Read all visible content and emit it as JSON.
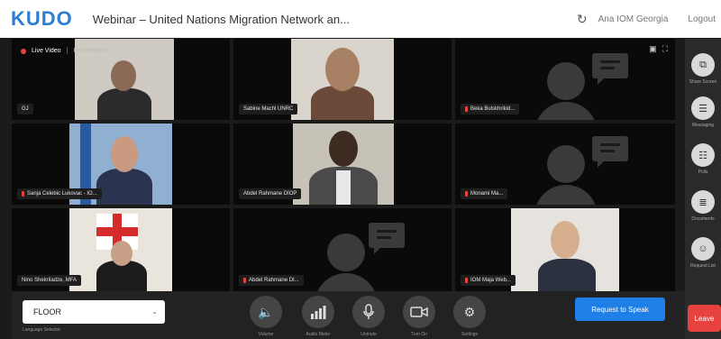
{
  "topbar": {
    "logo": "KUDO",
    "title": "Webinar – United Nations Migration Network an...",
    "refresh_icon": "refresh-icon",
    "user": "Ana IOM Georgia",
    "logout": "Logout"
  },
  "stage": {
    "live_label": "Live Video",
    "separator": "|",
    "presentation_label": "Presentation"
  },
  "tiles": [
    {
      "name": "GJ",
      "muted": false,
      "type": "video"
    },
    {
      "name": "Sabine Machl UNRC",
      "muted": false,
      "type": "video"
    },
    {
      "name": "Beka Bulskhrikid...",
      "muted": true,
      "type": "avatar"
    },
    {
      "name": "Sanja Celebic Lukovac - IO...",
      "muted": true,
      "type": "video"
    },
    {
      "name": "Abdel Rahmane DIOP",
      "muted": false,
      "type": "video"
    },
    {
      "name": "Monami Ma...",
      "muted": true,
      "type": "avatar"
    },
    {
      "name": "Nino Shekriladze, MFA",
      "muted": false,
      "type": "video"
    },
    {
      "name": "Abdel Rahmane DI...",
      "muted": true,
      "type": "avatar"
    },
    {
      "name": "IOM Maja Web...",
      "muted": true,
      "type": "video"
    }
  ],
  "sidebar": [
    {
      "label": "Share Screen",
      "icon": "share-screen-icon"
    },
    {
      "label": "Messaging",
      "icon": "messaging-icon"
    },
    {
      "label": "Polls",
      "icon": "polls-icon"
    },
    {
      "label": "Documents",
      "icon": "documents-icon"
    },
    {
      "label": "Request List",
      "icon": "request-list-icon"
    }
  ],
  "bottombar": {
    "floor_value": "FLOOR",
    "language_selector_label": "Language Selector",
    "controls": [
      {
        "label": "Volume",
        "icon": "volume-icon"
      },
      {
        "label": "Audio Meter",
        "icon": "audio-meter-icon"
      },
      {
        "label": "Unmute",
        "icon": "microphone-icon"
      },
      {
        "label": "Turn On",
        "icon": "camera-icon"
      },
      {
        "label": "Settings",
        "icon": "settings-gear-icon"
      }
    ],
    "request_to_speak": "Request to Speak",
    "leave": "Leave"
  },
  "colors": {
    "accent": "#1e7fe6",
    "leave": "#e8423f",
    "logo_blue": "#2d7dd2"
  }
}
